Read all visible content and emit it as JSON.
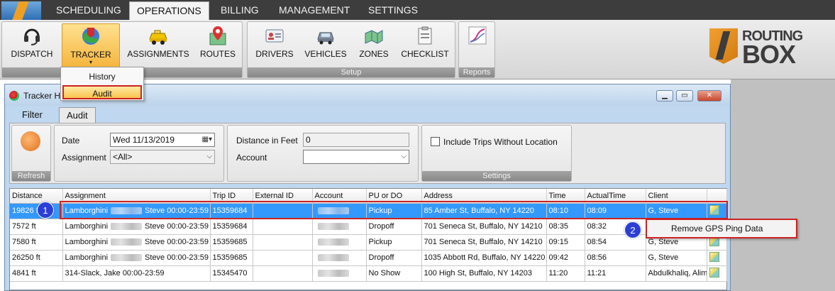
{
  "menu": {
    "items": [
      "SCHEDULING",
      "OPERATIONS",
      "BILLING",
      "MANAGEMENT",
      "SETTINGS"
    ],
    "active": "OPERATIONS"
  },
  "ribbon": {
    "main_buttons": [
      "DISPATCH",
      "TRACKER",
      "ASSIGNMENTS",
      "ROUTES"
    ],
    "setup_buttons": [
      "DRIVERS",
      "VEHICLES",
      "ZONES",
      "CHECKLIST"
    ],
    "setup_label": "Setup",
    "reports_label": "Reports"
  },
  "brand": {
    "line1": "ROUTING",
    "line2": "BOX"
  },
  "tracker_dropdown": {
    "items": [
      "History",
      "Audit"
    ],
    "highlighted": "Audit"
  },
  "window": {
    "title": "Tracker Hi",
    "tabs": [
      "Filter",
      "Audit"
    ],
    "active_tab": "Audit"
  },
  "filters": {
    "refresh_label": "Refresh",
    "date_label": "Date",
    "date_value": "Wed 11/13/2019",
    "assignment_label": "Assignment",
    "assignment_value": "<All>",
    "distance_label": "Distance in Feet",
    "distance_value": "0",
    "account_label": "Account",
    "account_value": "",
    "include_trips_label": "Include Trips Without Location",
    "settings_label": "Settings"
  },
  "grid": {
    "columns": [
      "Distance",
      "Assignment",
      "Trip ID",
      "External ID",
      "Account",
      "PU or DO",
      "Address",
      "Time",
      "ActualTime",
      "Client"
    ],
    "rows": [
      {
        "distance": "19826 ft",
        "assign_a": "Lamborghini",
        "assign_b": "Steve 00:00-23:59",
        "trip": "15359684",
        "ext": "",
        "pu": "Pickup",
        "address": "85 Amber St, Buffalo, NY 14220",
        "time": "08:10",
        "actual": "08:09",
        "client": "G, Steve",
        "selected": true
      },
      {
        "distance": "7572 ft",
        "assign_a": "Lamborghini",
        "assign_b": "Steve 00:00-23:59",
        "trip": "15359684",
        "ext": "",
        "pu": "Dropoff",
        "address": "701 Seneca St, Buffalo, NY 14210",
        "time": "08:35",
        "actual": "08:32",
        "client": "",
        "selected": false
      },
      {
        "distance": "7580 ft",
        "assign_a": "Lamborghini",
        "assign_b": "Steve 00:00-23:59",
        "trip": "15359685",
        "ext": "",
        "pu": "Pickup",
        "address": "701 Seneca St, Buffalo, NY 14210",
        "time": "09:15",
        "actual": "08:54",
        "client": "G, Steve",
        "selected": false
      },
      {
        "distance": "26250 ft",
        "assign_a": "Lamborghini",
        "assign_b": "Steve 00:00-23:59",
        "trip": "15359685",
        "ext": "",
        "pu": "Dropoff",
        "address": "1035 Abbott Rd, Buffalo, NY 14220",
        "time": "09:42",
        "actual": "08:56",
        "client": "G, Steve",
        "selected": false
      },
      {
        "distance": "4841 ft",
        "assign_a": "314-Slack, Jake 00:00-23:59",
        "assign_b": "",
        "trip": "15345470",
        "ext": "",
        "pu": "No Show",
        "address": "100 High St, Buffalo, NY 14203",
        "time": "11:20",
        "actual": "11:21",
        "client": "Abdulkhaliq, Alim",
        "selected": false
      }
    ]
  },
  "context_menu": {
    "item": "Remove GPS Ping Data"
  },
  "annotations": {
    "badge1": "1",
    "badge2": "2"
  }
}
